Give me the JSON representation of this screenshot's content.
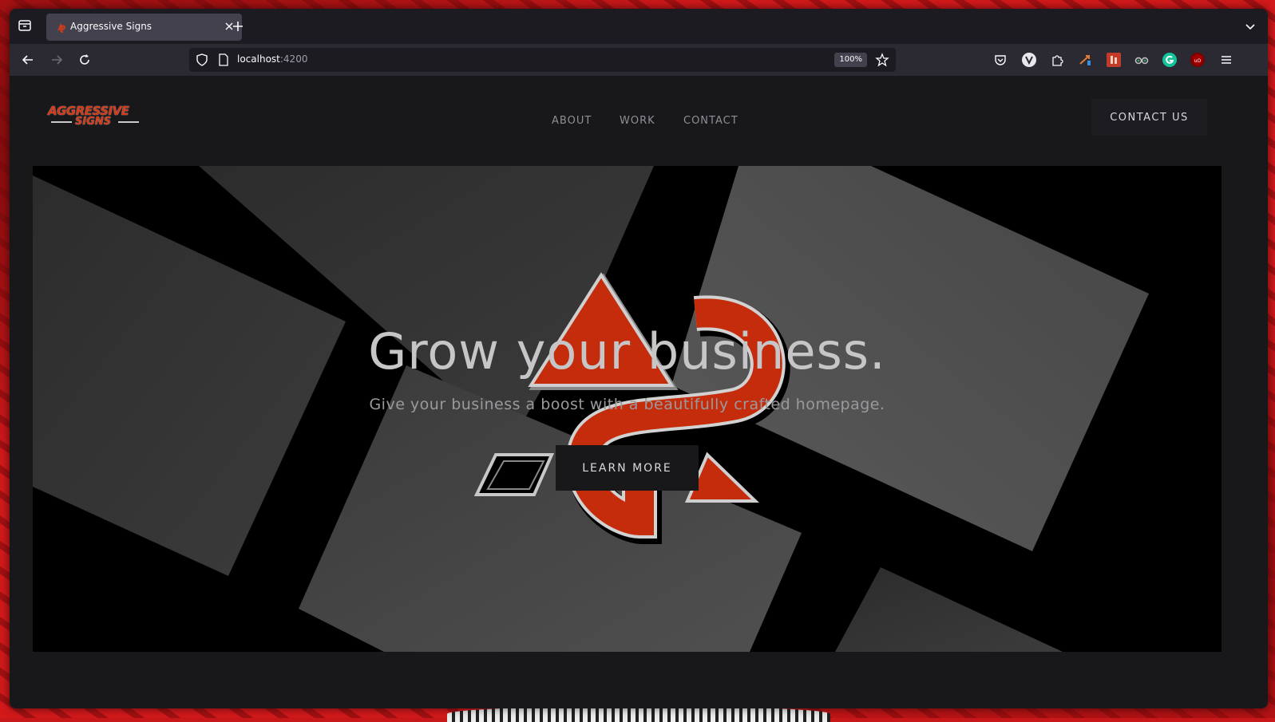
{
  "browser": {
    "tab_title": "Aggressive Signs",
    "url_host": "localhost",
    "url_port": ":4200",
    "zoom_level": "100%"
  },
  "site": {
    "logo": {
      "line1": "AGGRESSIVE",
      "line2": "SIGNS"
    },
    "nav": {
      "about": "ABOUT",
      "work": "WORK",
      "contact": "CONTACT"
    },
    "cta_label": "CONTACT US",
    "hero": {
      "title": "Grow your business.",
      "subtitle": "Give your business a boost with a beautifully crafted homepage.",
      "button_label": "LEARN MORE"
    }
  },
  "colors": {
    "brand_red": "#d23a1a",
    "page_bg": "#18181b",
    "browser_chrome": "#2b2a33"
  },
  "icons": {
    "toolbar": [
      "back-icon",
      "forward-icon",
      "reload-icon",
      "shield-icon",
      "page-icon",
      "star-icon",
      "pocket-icon",
      "extensions-icon",
      "menu-icon"
    ]
  }
}
